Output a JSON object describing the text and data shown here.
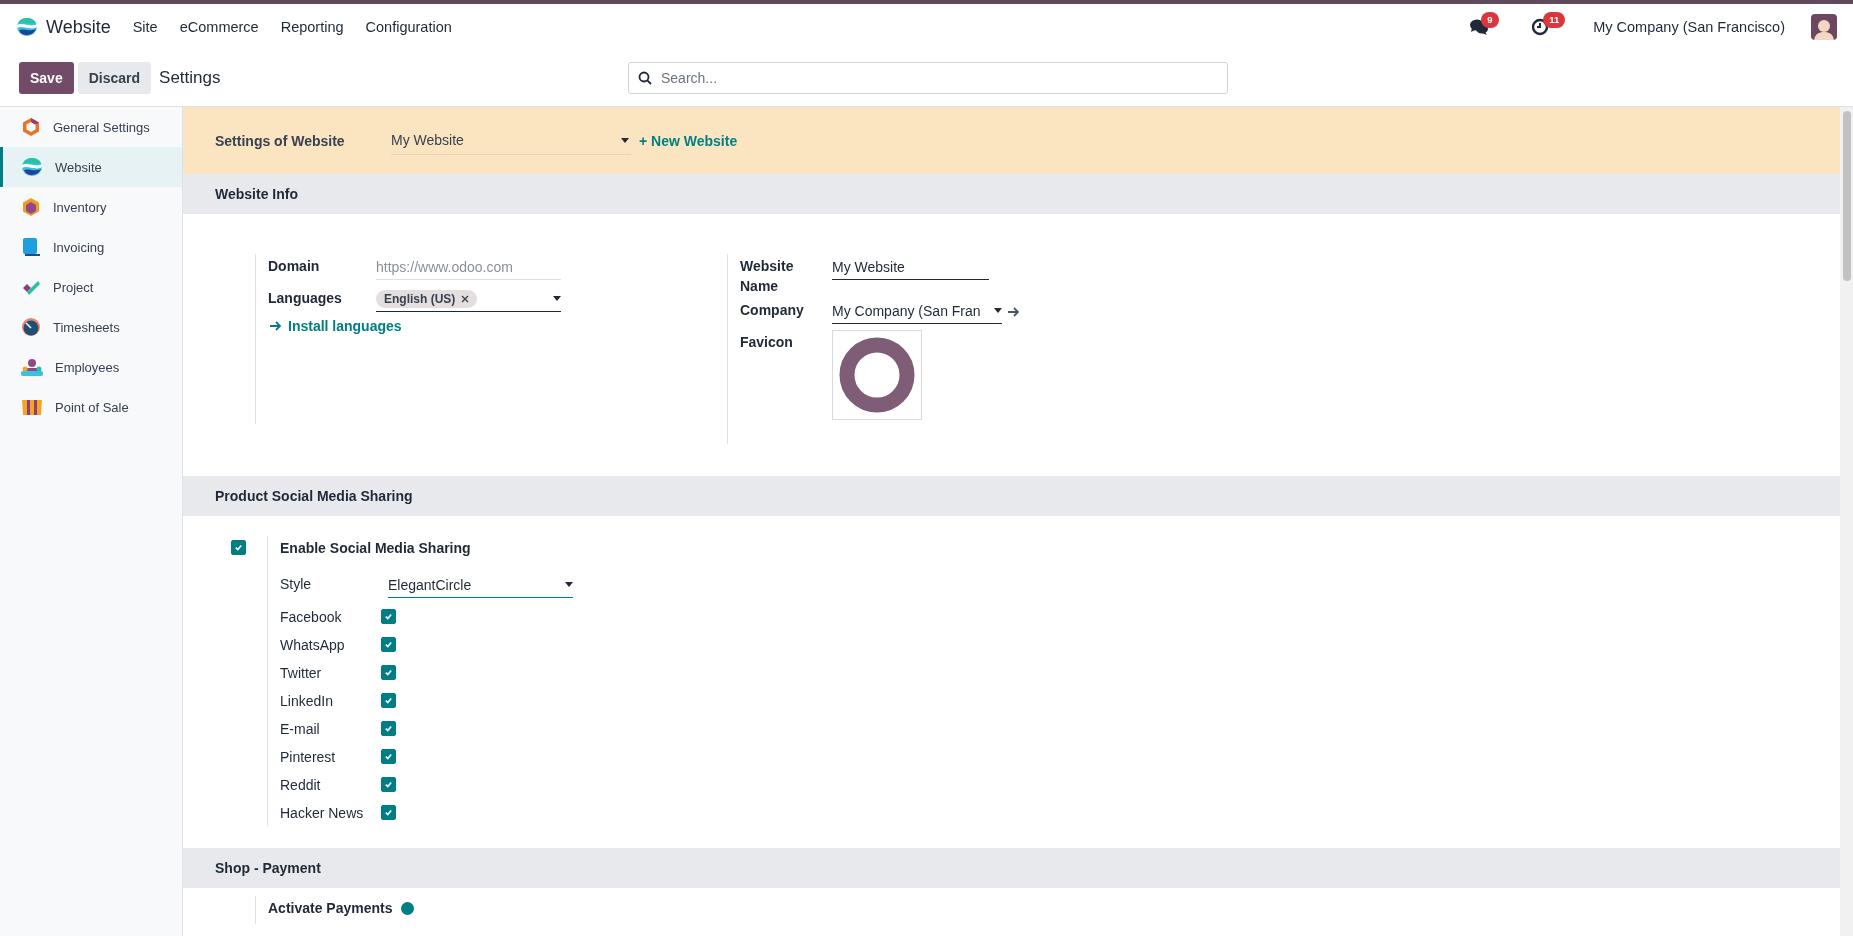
{
  "topbar": {
    "app_name": "Website",
    "menu": [
      "Site",
      "eCommerce",
      "Reporting",
      "Configuration"
    ],
    "notifications": [
      {
        "kind": "messages",
        "count": "9"
      },
      {
        "kind": "activities",
        "count": "11"
      }
    ],
    "company": "My Company (San Francisco)"
  },
  "control_bar": {
    "save": "Save",
    "discard": "Discard",
    "breadcrumb": "Settings",
    "search": {
      "placeholder": "Search..."
    }
  },
  "sidebar": {
    "items": [
      {
        "label": "General Settings",
        "selected": false
      },
      {
        "label": "Website",
        "selected": true
      },
      {
        "label": "Inventory",
        "selected": false
      },
      {
        "label": "Invoicing",
        "selected": false
      },
      {
        "label": "Project",
        "selected": false
      },
      {
        "label": "Timesheets",
        "selected": false
      },
      {
        "label": "Employees",
        "selected": false
      },
      {
        "label": "Point of Sale",
        "selected": false
      }
    ]
  },
  "website_selector": {
    "label": "Settings of Website",
    "value": "My Website",
    "new_link": "+ New Website"
  },
  "website_info": {
    "title": "Website Info",
    "domain": {
      "label": "Domain",
      "placeholder": "https://www.odoo.com"
    },
    "languages": {
      "label": "Languages",
      "tags": [
        "English (US)"
      ]
    },
    "install_link": "Install languages",
    "website_name": {
      "label": "Website Name",
      "value": "My Website"
    },
    "company": {
      "label": "Company",
      "value": "My Company (San Fran"
    },
    "favicon": {
      "label": "Favicon"
    }
  },
  "social_sharing": {
    "title": "Product Social Media Sharing",
    "enable": {
      "label": "Enable Social Media Sharing",
      "checked": true
    },
    "style": {
      "label": "Style",
      "value": "ElegantCircle"
    },
    "networks": [
      {
        "label": "Facebook",
        "checked": true
      },
      {
        "label": "WhatsApp",
        "checked": true
      },
      {
        "label": "Twitter",
        "checked": true
      },
      {
        "label": "LinkedIn",
        "checked": true
      },
      {
        "label": "E-mail",
        "checked": true
      },
      {
        "label": "Pinterest",
        "checked": true
      },
      {
        "label": "Reddit",
        "checked": true
      },
      {
        "label": "Hacker News",
        "checked": true
      }
    ]
  },
  "shop_payment": {
    "title": "Shop - Payment",
    "settings": [
      {
        "label": "Activate Payments"
      }
    ]
  }
}
